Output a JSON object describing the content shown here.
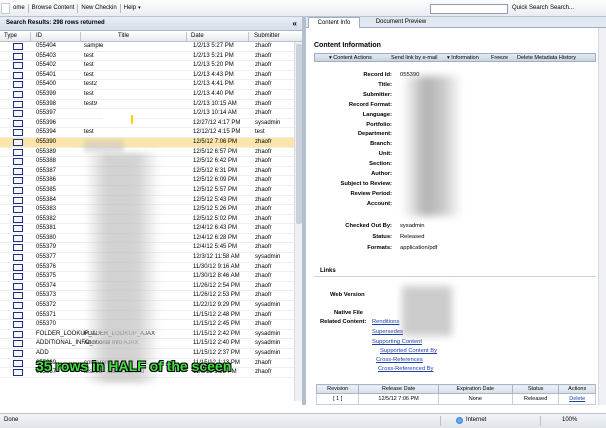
{
  "menubar": {
    "items": [
      "ome",
      "Browse Content",
      "New Checkin",
      "Help"
    ],
    "help_arrow": "▾",
    "quick_search": "Quick Search",
    "search_more": "Search..."
  },
  "left": {
    "header": "Search Results: 298 rows returned",
    "collapse": "«",
    "columns": [
      "Type",
      "ID",
      "Title",
      "Date",
      "Submitter"
    ],
    "rows": [
      {
        "id": "055404",
        "title": "sample",
        "date": "1/2/13 5:27 PM",
        "sub": "zhaofr"
      },
      {
        "id": "055403",
        "title": "test",
        "date": "1/2/13 5:21 PM",
        "sub": "zhaofr"
      },
      {
        "id": "055402",
        "title": "test",
        "date": "1/2/13 5:20 PM",
        "sub": "zhaofr"
      },
      {
        "id": "055401",
        "title": "test",
        "date": "1/2/13 4:43 PM",
        "sub": "zhaofr"
      },
      {
        "id": "055400",
        "title": "test2",
        "date": "1/2/13 4:41 PM",
        "sub": "zhaofr"
      },
      {
        "id": "055399",
        "title": "test",
        "date": "1/2/13 4:40 PM",
        "sub": "zhaofr"
      },
      {
        "id": "055398",
        "title": "test9",
        "date": "1/2/13 10:15 AM",
        "sub": "zhaofr"
      },
      {
        "id": "055397",
        "title": "",
        "date": "1/2/13 10:14 AM",
        "sub": "zhaofr"
      },
      {
        "id": "055396",
        "title": "",
        "date": "12/27/12 4:17 PM",
        "sub": "sysadmin"
      },
      {
        "id": "055394",
        "title": "test",
        "date": "12/12/12 4:15 PM",
        "sub": "test"
      },
      {
        "id": "055390",
        "title": "",
        "date": "12/5/12 7:06 PM",
        "sub": "zhaofr",
        "selected": true
      },
      {
        "id": "055389",
        "title": "",
        "date": "12/5/12 6:57 PM",
        "sub": "zhaofr"
      },
      {
        "id": "055388",
        "title": "",
        "date": "12/5/12 6:42 PM",
        "sub": "zhaofr"
      },
      {
        "id": "055387",
        "title": "",
        "date": "12/5/12 6:31 PM",
        "sub": "zhaofr"
      },
      {
        "id": "055386",
        "title": "",
        "date": "12/5/12 6:09 PM",
        "sub": "zhaofr"
      },
      {
        "id": "055385",
        "title": "",
        "date": "12/5/12 5:57 PM",
        "sub": "zhaofr"
      },
      {
        "id": "055384",
        "title": "",
        "date": "12/5/12 5:43 PM",
        "sub": "zhaofr"
      },
      {
        "id": "055383",
        "title": "",
        "date": "12/5/12 5:26 PM",
        "sub": "zhaofr"
      },
      {
        "id": "055382",
        "title": "",
        "date": "12/5/12 5:02 PM",
        "sub": "zhaofr"
      },
      {
        "id": "055381",
        "title": "",
        "date": "12/4/12 6:43 PM",
        "sub": "zhaofr"
      },
      {
        "id": "055380",
        "title": "",
        "date": "12/4/12 6:28 PM",
        "sub": "zhaofr"
      },
      {
        "id": "055379",
        "title": "",
        "date": "12/4/12 5:45 PM",
        "sub": "zhaofr"
      },
      {
        "id": "055377",
        "title": "",
        "date": "12/3/12 11:58 AM",
        "sub": "sysadmin"
      },
      {
        "id": "055376",
        "title": "",
        "date": "11/30/12 9:16 AM",
        "sub": "zhaofr"
      },
      {
        "id": "055375",
        "title": "",
        "date": "11/30/12 8:46 AM",
        "sub": "zhaofr"
      },
      {
        "id": "055374",
        "title": "",
        "date": "11/26/12 2:54 PM",
        "sub": "zhaofr"
      },
      {
        "id": "055373",
        "title": "",
        "date": "11/26/12 2:53 PM",
        "sub": "zhaofr"
      },
      {
        "id": "055372",
        "title": "",
        "date": "11/22/12 9:29 PM",
        "sub": "sysadmin"
      },
      {
        "id": "055371",
        "title": "",
        "date": "11/15/12 2:48 PM",
        "sub": "zhaofr"
      },
      {
        "id": "055370",
        "title": "",
        "date": "11/15/12 2:45 PM",
        "sub": "zhaofr"
      },
      {
        "id": "FOLDER_LOOKUP_A",
        "title": "FOLDER_LOOKUP_AJAX",
        "date": "11/15/12 2:42 PM",
        "sub": "sysadmin"
      },
      {
        "id": "ADDITIONAL_INFO_",
        "title": "Additional Info AJAX",
        "date": "11/15/12 2:40 PM",
        "sub": "sysadmin"
      },
      {
        "id": "ADD",
        "title": "",
        "date": "11/15/12 2:37 PM",
        "sub": "sysadmin"
      },
      {
        "id": "055369",
        "title": "compTemp",
        "date": "11/15/12 1:13 PM",
        "sub": "zhaofr"
      },
      {
        "id": "055367",
        "title": "test 03 - additional info",
        "date": "11/6/12 1:25 PM",
        "sub": "zhaofr"
      }
    ],
    "annotation": "35 rows in HALF of the sceen"
  },
  "right": {
    "tabs": [
      "Content Info",
      "Document Preview"
    ],
    "section_title": "Content Information",
    "toolbar": [
      "▾ Content Actions",
      "Send link by e-mail",
      "▾ Information",
      "Freeze",
      "Delete Metadata History"
    ],
    "fields": [
      {
        "label": "Record Id:",
        "value": "055390"
      },
      {
        "label": "Title:",
        "value": ""
      },
      {
        "label": "Submitter:",
        "value": ""
      },
      {
        "label": "Record Format:",
        "value": ""
      },
      {
        "label": "Language:",
        "value": ""
      },
      {
        "label": "Portfolio:",
        "value": ""
      },
      {
        "label": "Department:",
        "value": ""
      },
      {
        "label": "Branch:",
        "value": ""
      },
      {
        "label": "Unit:",
        "value": ""
      },
      {
        "label": "Section:",
        "value": ""
      },
      {
        "label": "Author:",
        "value": ""
      },
      {
        "label": "Subject to Review:",
        "value": ""
      },
      {
        "label": "Review Period:",
        "value": ""
      },
      {
        "label": "Account:",
        "value": ""
      }
    ],
    "checkout": [
      {
        "label": "Checked Out By:",
        "value": "sysadmin"
      },
      {
        "label": "Status:",
        "value": "Released"
      },
      {
        "label": "Formats:",
        "value": "application/pdf"
      }
    ],
    "links_title": "Links",
    "web_version": "Web Version",
    "native_file": "Native File",
    "related_label": "Related Content:",
    "related": [
      "Renditions",
      "Supersedes",
      "Supporting Content",
      "Supported Content By",
      "Cross-References",
      "Cross-Referenced By"
    ],
    "rev_table": {
      "headers": [
        "Revision",
        "Release Date",
        "Expiration Date",
        "Status",
        "Actions"
      ],
      "row": [
        "[ 1 ]",
        "12/5/12 7:06 PM",
        "None",
        "Released",
        "Delete"
      ]
    }
  },
  "status": {
    "done": "Done",
    "internet": "Internet",
    "zoom": "100%"
  }
}
